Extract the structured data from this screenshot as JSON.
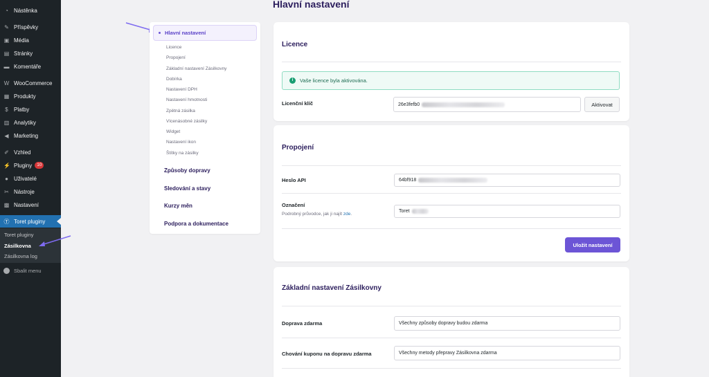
{
  "sidebar": {
    "items": [
      {
        "label": "Nástěnka",
        "icon": "dashboard-icon"
      },
      {
        "label": "Příspěvky",
        "icon": "pin-icon"
      },
      {
        "label": "Média",
        "icon": "media-icon"
      },
      {
        "label": "Stránky",
        "icon": "pages-icon"
      },
      {
        "label": "Komentáře",
        "icon": "comments-icon"
      },
      {
        "label": "WooCommerce",
        "icon": "woocommerce-icon"
      },
      {
        "label": "Produkty",
        "icon": "products-icon"
      },
      {
        "label": "Platby",
        "icon": "payments-icon"
      },
      {
        "label": "Analytiky",
        "icon": "analytics-icon"
      },
      {
        "label": "Marketing",
        "icon": "marketing-icon"
      },
      {
        "label": "Vzhled",
        "icon": "appearance-icon"
      },
      {
        "label": "Pluginy",
        "icon": "plugins-icon",
        "badge": "10"
      },
      {
        "label": "Uživatelé",
        "icon": "users-icon"
      },
      {
        "label": "Nástroje",
        "icon": "tools-icon"
      },
      {
        "label": "Nastavení",
        "icon": "settings-icon"
      },
      {
        "label": "Toret pluginy",
        "icon": "toret-icon"
      }
    ],
    "submenu": [
      "Toret pluginy",
      "Zásilkovna",
      "Zásilkovna log"
    ],
    "collapse_label": "Sbalit menu"
  },
  "page": {
    "title": "Hlavní nastavení"
  },
  "leftnav": {
    "active": "Hlavní nastavení",
    "subitems": [
      "Licence",
      "Propojení",
      "Základní nastavení Zásilkovny",
      "Dobírka",
      "Nastavení DPH",
      "Nastavení hmotnosti",
      "Zpětná zásilka",
      "Vícenásobné zásilky",
      "Widget",
      "Nastavení ikon",
      "Štítky na zásilky"
    ],
    "sections": [
      "Způsoby dopravy",
      "Sledování a stavy",
      "Kurzy měn",
      "Podpora a dokumentace"
    ]
  },
  "licence": {
    "title": "Licence",
    "notice": "Vaše licence byla aktivována.",
    "key_label": "Licenční klíč",
    "key_value": "26e3fefb0",
    "activate_label": "Aktivovat"
  },
  "propojeni": {
    "title": "Propojení",
    "api_label": "Heslo API",
    "api_value": "64bf918",
    "oznaceni_label": "Označení",
    "oznaceni_help": "Podrobný průvodce, jak ji najít",
    "oznaceni_help_link": "zde",
    "oznaceni_help_end": ".",
    "oznaceni_value": "Toret",
    "save_label": "Uložit nastavení"
  },
  "zakladni": {
    "title": "Základní nastavení Zásilkovny",
    "doprava_label": "Doprava zdarma",
    "doprava_value": "Všechny způsoby dopravy budou zdarma",
    "kupon_label": "Chování kuponu na dopravu zdarma",
    "kupon_value": "Všechny metody přepravy Zásilkovna zdarma"
  },
  "colors": {
    "accent": "#6c55d6",
    "title": "#2b1d5c",
    "wp_blue": "#2271b1",
    "sidebar_bg": "#1d2327"
  }
}
